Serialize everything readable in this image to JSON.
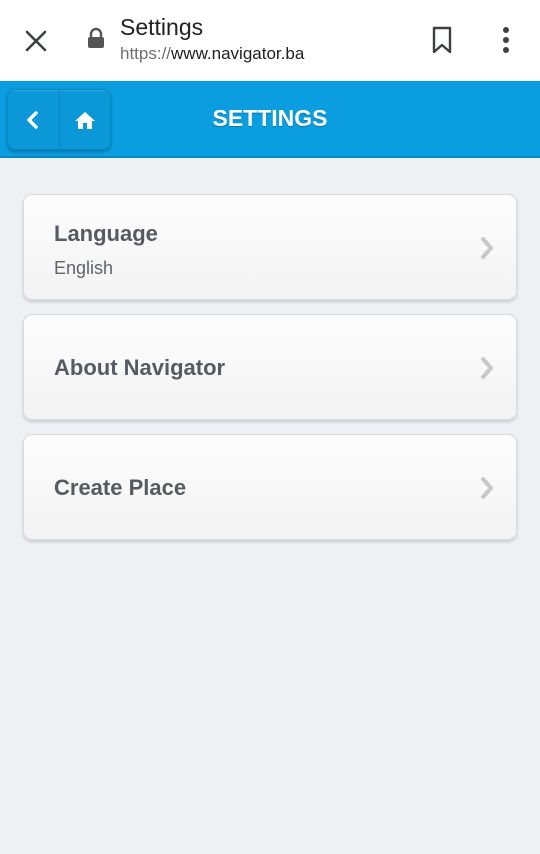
{
  "browser": {
    "page_title": "Settings",
    "url_scheme": "https://",
    "url_host": "www.navigator.ba"
  },
  "header": {
    "title": "SETTINGS"
  },
  "settings": {
    "items": [
      {
        "label": "Language",
        "value": "English"
      },
      {
        "label": "About Navigator"
      },
      {
        "label": "Create Place"
      }
    ]
  },
  "colors": {
    "header_bg": "#0a9ee0",
    "page_bg": "#eef1f3",
    "item_text": "#555b60"
  }
}
